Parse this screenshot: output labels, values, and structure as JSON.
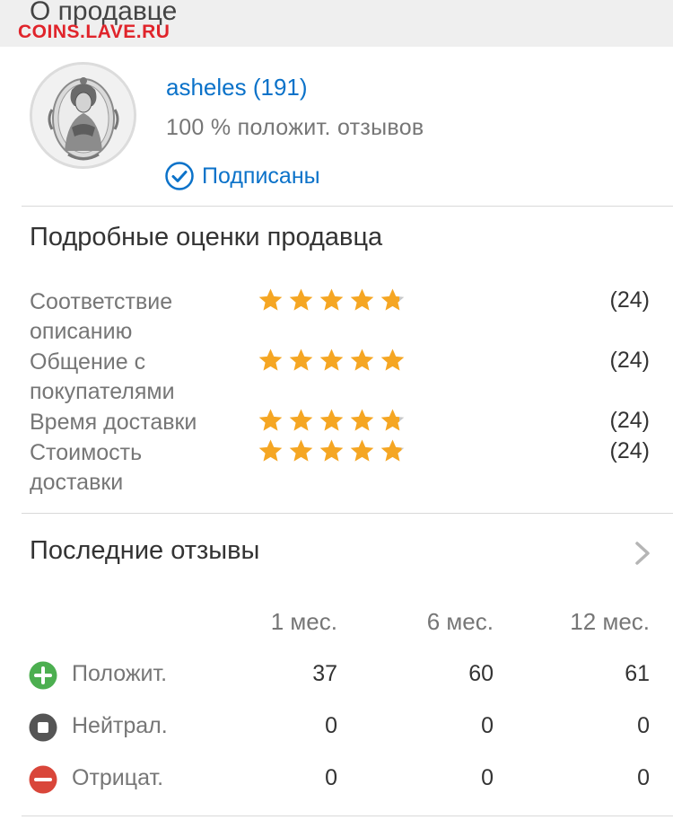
{
  "section_title": "О продавце",
  "watermark": "COINS.LAVE.RU",
  "seller": {
    "name": "asheles (191)",
    "feedback_text": "100 % положит. отзывов",
    "follow_label": "Подписаны"
  },
  "ratings": {
    "title": "Подробные оценки продавца",
    "items": [
      {
        "label_lines": [
          "Соответствие",
          "описанию"
        ],
        "stars": 4.8,
        "count": "(24)"
      },
      {
        "label_lines": [
          "Общение с",
          "покупателями"
        ],
        "stars": 5.0,
        "count": "(24)"
      },
      {
        "label_lines": [
          "Время доставки"
        ],
        "stars": 4.8,
        "count": "(24)"
      },
      {
        "label_lines": [
          "Стоимость",
          "доставки"
        ],
        "stars": 4.9,
        "count": "(24)"
      }
    ]
  },
  "recent": {
    "title": "Последние отзывы",
    "columns": [
      "1 мес.",
      "6 мес.",
      "12 мес."
    ],
    "rows": [
      {
        "label": "Положит.",
        "icon": "plus-circle-icon",
        "color": "#4caf50",
        "values": [
          "37",
          "60",
          "61"
        ]
      },
      {
        "label": "Нейтрал.",
        "icon": "stop-circle-icon",
        "color": "#555555",
        "values": [
          "0",
          "0",
          "0"
        ]
      },
      {
        "label": "Отрицат.",
        "icon": "minus-circle-icon",
        "color": "#d9463a",
        "values": [
          "0",
          "0",
          "0"
        ]
      }
    ]
  },
  "colors": {
    "link": "#0b72c9",
    "star": "#f5a623",
    "star_empty": "#c8c8c8"
  }
}
